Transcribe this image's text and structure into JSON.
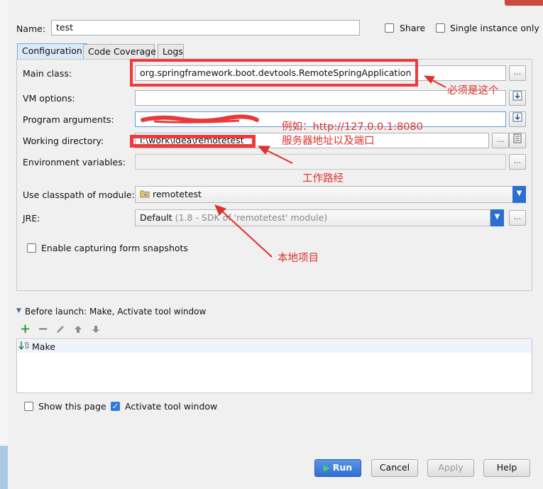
{
  "header": {
    "name_label": "Name:",
    "name_value": "test",
    "share_label": "Share",
    "single_instance_label": "Single instance only"
  },
  "tabs": [
    {
      "label": "Configuration",
      "active": true
    },
    {
      "label": "Code Coverage",
      "active": false
    },
    {
      "label": "Logs",
      "active": false
    }
  ],
  "form": {
    "main_class_label": "Main class:",
    "main_class_value": "org.springframework.boot.devtools.RemoteSpringApplication",
    "vm_options_label": "VM options:",
    "vm_options_value": "",
    "program_args_label": "Program arguments:",
    "working_dir_label": "Working directory:",
    "working_dir_value": "I:\\work\\idea\\remotetest",
    "env_vars_label": "Environment variables:",
    "classpath_label": "Use classpath of module:",
    "classpath_value": "remotetest",
    "jre_label": "JRE:",
    "jre_default": "Default",
    "jre_detail": "(1.8 - SDK of 'remotetest' module)",
    "browse_label": "...",
    "snapshots_label": "Enable capturing form snapshots"
  },
  "before_launch": {
    "title": "Before launch: Make, Activate tool window",
    "items": [
      "Make"
    ]
  },
  "footer": {
    "show_page_label": "Show this page",
    "activate_label": "Activate tool window",
    "activate_checked": true,
    "run_label": "Run",
    "cancel_label": "Cancel",
    "apply_label": "Apply",
    "help_label": "Help"
  },
  "annotations": {
    "main_class_note": "必须是这个",
    "args_note_1": "例如：http://127.0.0.1:8080",
    "args_note_2": "服务器地址以及端口",
    "workdir_note": "工作路经",
    "module_note": "本地项目"
  },
  "colors": {
    "annotation_red": "#e0312a",
    "accent_blue": "#2f6fd2"
  }
}
